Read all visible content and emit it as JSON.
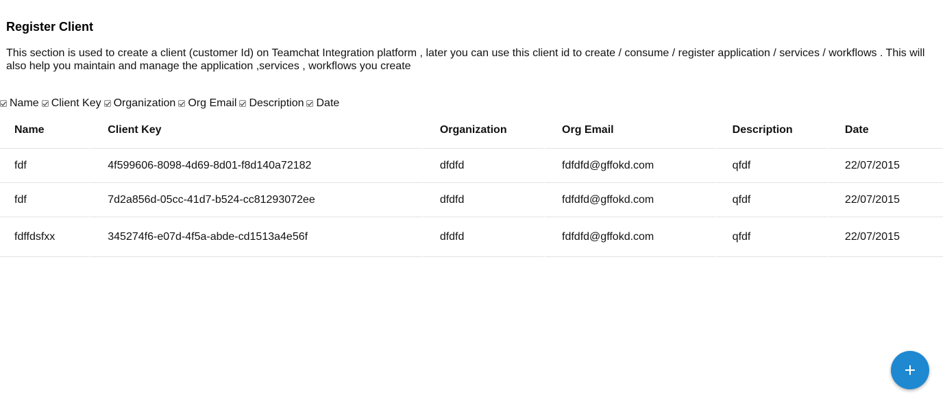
{
  "header": {
    "title": "Register Client",
    "description": "This section is used to create a client (customer Id) on Teamchat Integration platform , later you can use this client id to create / consume / register application / services / workflows . This will also help you maintain and manage the application ,services , workflows you create"
  },
  "column_toggles": [
    {
      "label": "Name",
      "checked": true
    },
    {
      "label": "Client Key",
      "checked": true
    },
    {
      "label": "Organization",
      "checked": true
    },
    {
      "label": "Org Email",
      "checked": true
    },
    {
      "label": "Description",
      "checked": true
    },
    {
      "label": "Date",
      "checked": true
    }
  ],
  "table": {
    "headers": [
      "Name",
      "Client Key",
      "Organization",
      "Org Email",
      "Description",
      "Date"
    ],
    "rows": [
      [
        "fdf",
        "4f599606-8098-4d69-8d01-f8d140a72182",
        "dfdfd",
        "fdfdfd@gffokd.com",
        "qfdf",
        "22/07/2015"
      ],
      [
        "fdf",
        "7d2a856d-05cc-41d7-b524-cc81293072ee",
        "dfdfd",
        "fdfdfd@gffokd.com",
        "qfdf",
        "22/07/2015"
      ],
      [
        "fdffdsfxx",
        "345274f6-e07d-4f5a-abde-cd1513a4e56f",
        "dfdfd",
        "fdfdfd@gffokd.com",
        "qfdf",
        "22/07/2015"
      ]
    ]
  },
  "fab": {
    "icon": "plus-icon",
    "color": "#1e88d0"
  }
}
